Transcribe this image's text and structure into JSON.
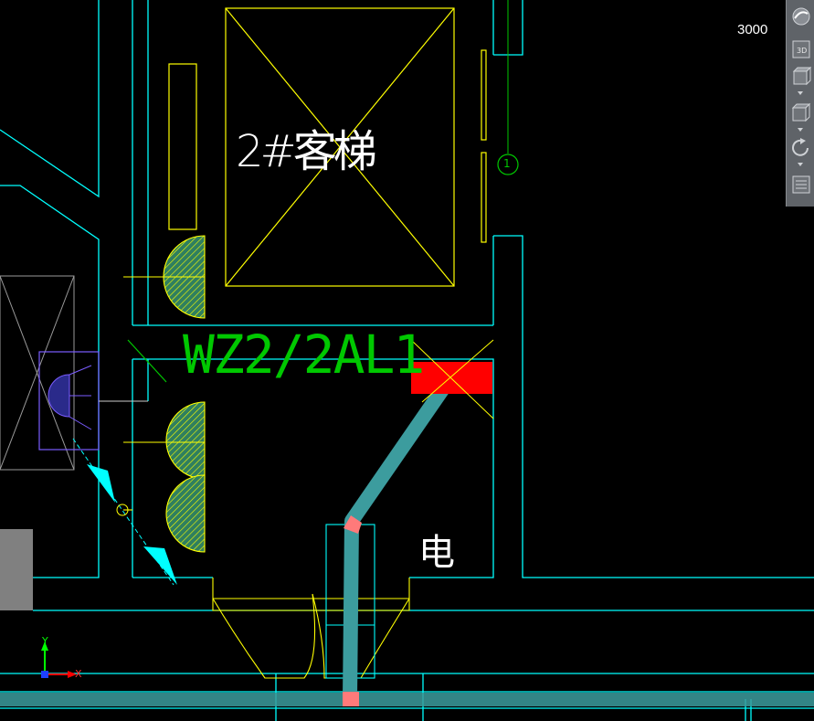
{
  "viewport": {
    "scale_readout": "3000"
  },
  "labels": {
    "elevator": "2#客梯",
    "circuit": "WZ2/2AL1",
    "room": "电",
    "grid_bubble": "1"
  },
  "ucs": {
    "x_axis": "X",
    "y_axis": "Y"
  },
  "toolbar": {
    "items": [
      {
        "name": "navigation-globe",
        "label": ""
      },
      {
        "name": "view-3d",
        "label": "3D"
      },
      {
        "name": "view-cube",
        "label": ""
      },
      {
        "name": "view-box",
        "label": ""
      },
      {
        "name": "orbit",
        "label": ""
      },
      {
        "name": "properties",
        "label": ""
      }
    ]
  },
  "colors": {
    "wall": "#00ffff",
    "door": "#ffff00",
    "text_green": "#00c800",
    "conduit": "#3c9c9e",
    "panel": "#ff0000",
    "fitting": "#ff7a7a"
  }
}
